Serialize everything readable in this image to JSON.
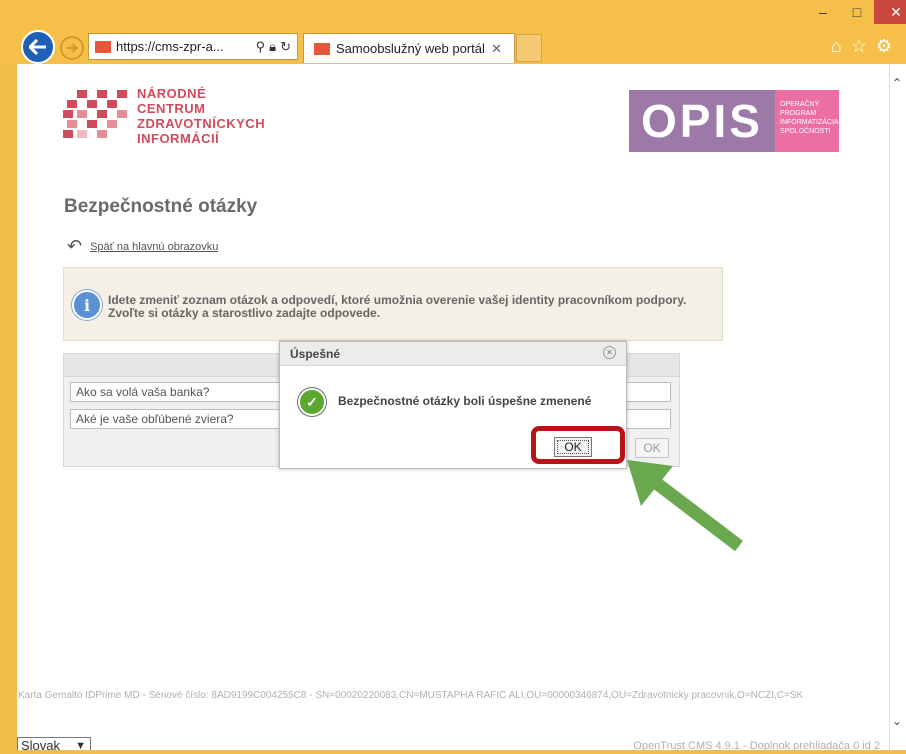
{
  "browser": {
    "url": "https://cms-zpr-a...",
    "tab_title": "Samoobslužný web portál",
    "window_controls": {
      "minimize": "–",
      "maximize": "□",
      "close": "✕"
    }
  },
  "logos": {
    "nczi_lines": [
      "NÁRODNÉ",
      "CENTRUM",
      "ZDRAVOTNÍCKYCH",
      "INFORMÁCIÍ"
    ],
    "opis_mark": "OPIS",
    "opis_small": [
      "OPERAČNÝ",
      "PROGRAM",
      "INFORMATIZÁCIA",
      "SPOLOČNOSTI"
    ]
  },
  "page": {
    "title": "Bezpečnostné otázky",
    "back_link": "Späť na hlavnú obrazovku",
    "info_text": "Idete zmeniť zoznam otázok a odpovedí, ktoré umožnia overenie vašej identity pracovníkom podpory. Zvoľte si otázky a starostlivo zadajte odpovede.",
    "questions": [
      "Ako sa volá vaša banka?",
      "Aké je vaše obľúbené zviera?"
    ],
    "ok_label": "OK"
  },
  "dialog": {
    "title": "Úspešné",
    "message": "Bezpečnostné otázky boli úspešne zmenené",
    "ok_label": "OK"
  },
  "footer": {
    "card_info": "Karta Gemalto IDPrime MD - Sériové číslo: 8AD9199C004255C8 - SN=00020220083,CN=MUSTAPHA RAFIC ALI,OU=00000346874,OU=Zdravotnicky pracovnik,O=NCZI,C=SK",
    "language": "Slovak",
    "version": "OpenTrust CMS 4.9.1 - Doplnok prehliadača 0 id 2"
  },
  "colors": {
    "highlight": "#b81316",
    "arrow": "#6aa84f",
    "chrome": "#f6bf4a"
  }
}
